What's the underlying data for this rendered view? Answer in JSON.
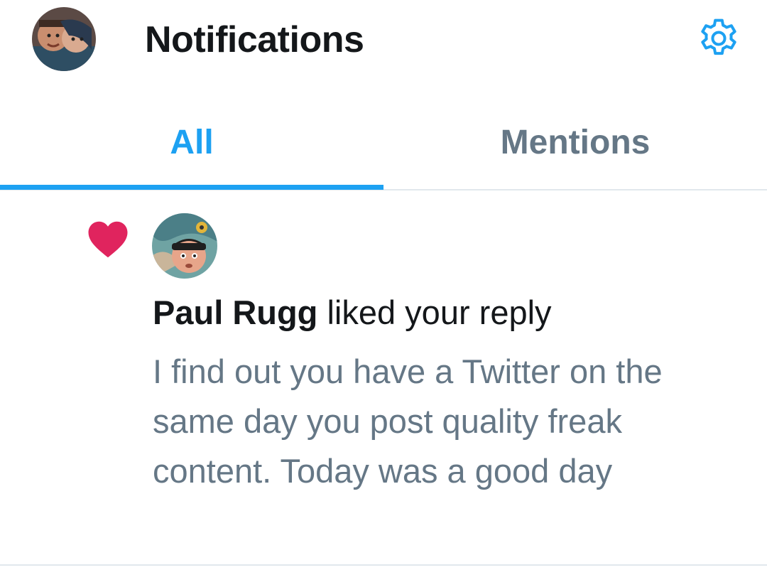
{
  "header": {
    "title": "Notifications",
    "avatar_icon": "user-avatar",
    "settings_icon": "gear-icon"
  },
  "tabs": [
    {
      "label": "All",
      "selected": true
    },
    {
      "label": "Mentions",
      "selected": false
    }
  ],
  "notifications": [
    {
      "icon": "heart-icon",
      "user": "Paul Rugg",
      "action": "liked your reply",
      "text": "I find out you have a Twitter on the same day you post quality freak content. Today was a good day"
    }
  ],
  "colors": {
    "accent": "#1da1f2",
    "like": "#e0245e",
    "text_primary": "#14171a",
    "text_secondary": "#657786",
    "divider": "#e1e8ed"
  }
}
